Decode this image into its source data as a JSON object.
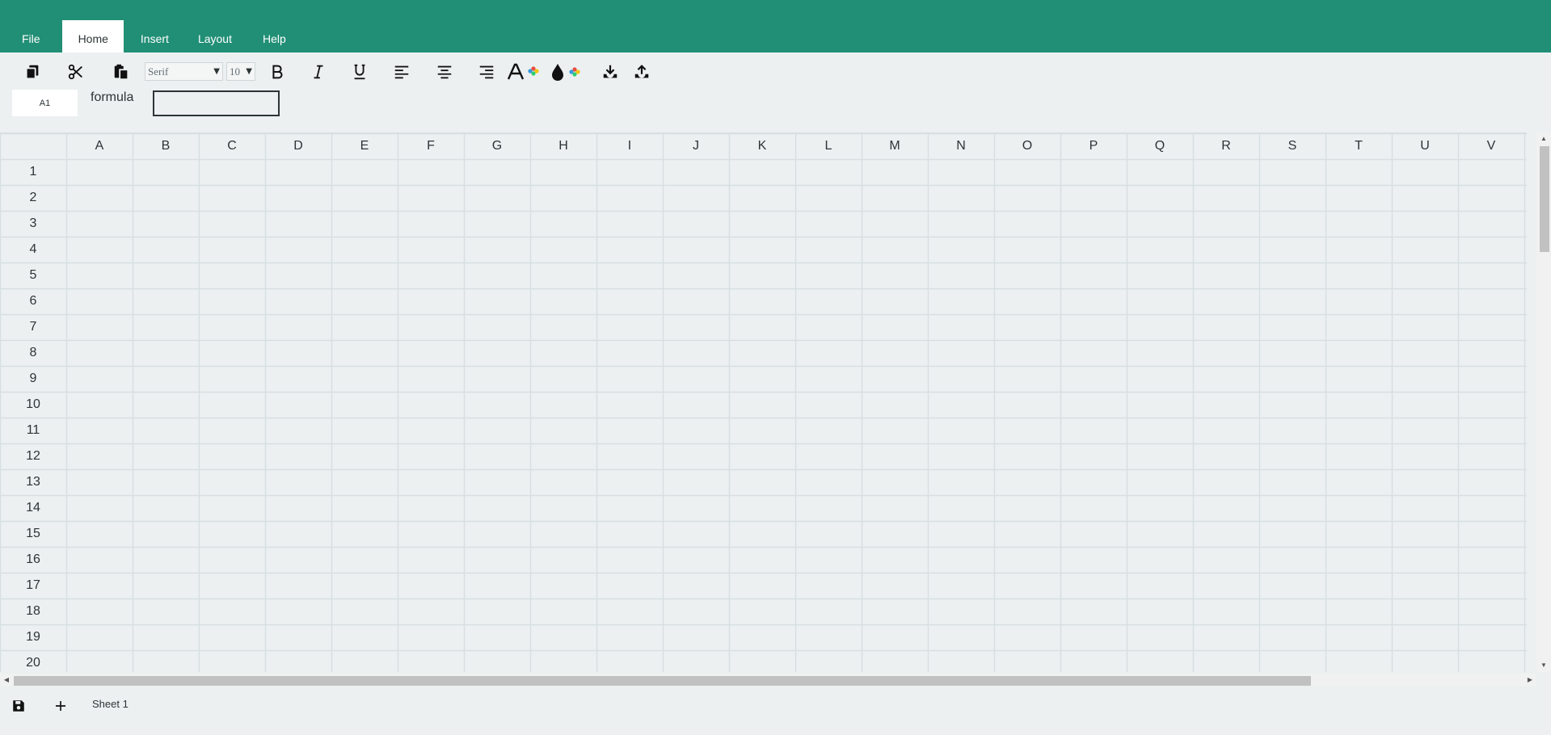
{
  "menu": {
    "items": [
      {
        "label": "File"
      },
      {
        "label": "Home"
      },
      {
        "label": "Insert"
      },
      {
        "label": "Layout"
      },
      {
        "label": "Help"
      }
    ]
  },
  "toolbar": {
    "font_family": "Serif",
    "font_size": "10",
    "icons": [
      "copy-icon",
      "cut-icon",
      "paste-icon",
      "bold-icon",
      "italic-icon",
      "underline-icon",
      "align-left-icon",
      "align-center-icon",
      "align-right-icon",
      "font-color-icon",
      "fill-color-icon",
      "download-icon",
      "upload-icon"
    ]
  },
  "formula_bar": {
    "cell_ref": "A1",
    "label": "formula",
    "value": ""
  },
  "grid": {
    "columns": [
      "A",
      "B",
      "C",
      "D",
      "E",
      "F",
      "G",
      "H",
      "I",
      "J",
      "K",
      "L",
      "M",
      "N",
      "O",
      "P",
      "Q",
      "R",
      "S",
      "T",
      "U",
      "V"
    ],
    "rows": [
      "1",
      "2",
      "3",
      "4",
      "5",
      "6",
      "7",
      "8",
      "9",
      "10",
      "11",
      "12",
      "13",
      "14",
      "15",
      "16",
      "17",
      "18",
      "19",
      "20"
    ]
  },
  "footer": {
    "sheet_name": "Sheet 1"
  },
  "colors": {
    "header": "#218f76",
    "background": "#ecf0f1",
    "text": "#2d3436"
  }
}
